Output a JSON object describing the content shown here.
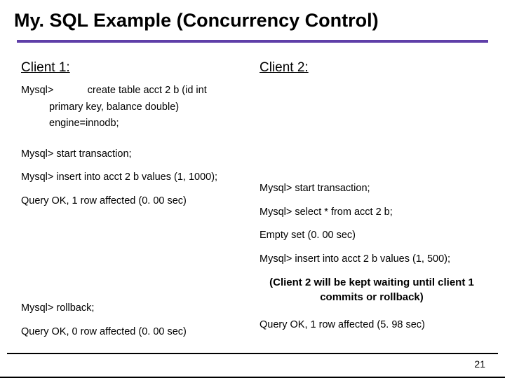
{
  "title": "My. SQL Example (Concurrency Control)",
  "client1": {
    "heading": "Client 1:",
    "l1a": "Mysql>            create table acct 2 b (id int",
    "l1b": "primary key, balance double)",
    "l1c": "engine=innodb;",
    "l2": "Mysql> start transaction;",
    "l3": "Mysql> insert into acct 2 b values (1, 1000);",
    "l4": "Query OK, 1 row affected (0. 00 sec)",
    "l5": "Mysql> rollback;",
    "l6": "Query OK, 0 row affected (0. 00 sec)"
  },
  "client2": {
    "heading": "Client 2:",
    "l1": "Mysql> start transaction;",
    "l2": "Mysql> select * from acct 2 b;",
    "l3": "Empty set (0. 00 sec)",
    "l4": "Mysql> insert into acct 2 b values (1, 500);",
    "note": "(Client 2 will be kept waiting until client 1 commits or rollback)",
    "l5": "Query OK, 1 row affected (5. 98 sec)"
  },
  "slide_number": "21"
}
